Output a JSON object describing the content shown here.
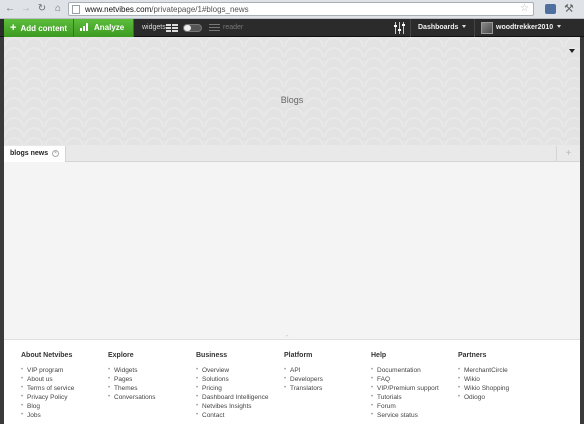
{
  "browser": {
    "url_domain": "www.netvibes.com",
    "url_path": "/privatepage/1#blogs_news"
  },
  "toolbar": {
    "add_content": "Add content",
    "analyze": "Analyze",
    "widgets_label": "widgets",
    "reader_label": "reader",
    "dashboards": "Dashboards",
    "username": "woodtrekker2010"
  },
  "header": {
    "title": "Blogs"
  },
  "tabs": [
    {
      "label": "blogs news"
    }
  ],
  "footer": {
    "columns": [
      {
        "title": "About Netvibes",
        "links": [
          "VIP program",
          "About us",
          "Terms of service",
          "Privacy Policy",
          "Blog",
          "Jobs"
        ]
      },
      {
        "title": "Explore",
        "links": [
          "Widgets",
          "Pages",
          "Themes",
          "Conversations"
        ]
      },
      {
        "title": "Business",
        "links": [
          "Overview",
          "Solutions",
          "Pricing",
          "Dashboard Intelligence",
          "Netvibes Insights",
          "Contact"
        ]
      },
      {
        "title": "Platform",
        "links": [
          "API",
          "Developers",
          "Translators"
        ]
      },
      {
        "title": "Help",
        "links": [
          "Documentation",
          "FAQ",
          "VIP/Premium support",
          "Tutorials",
          "Forum",
          "Service status"
        ]
      },
      {
        "title": "Partners",
        "links": [
          "MerchantCircle",
          "Wikio",
          "Wikio Shopping",
          "Odiogo"
        ]
      }
    ]
  }
}
